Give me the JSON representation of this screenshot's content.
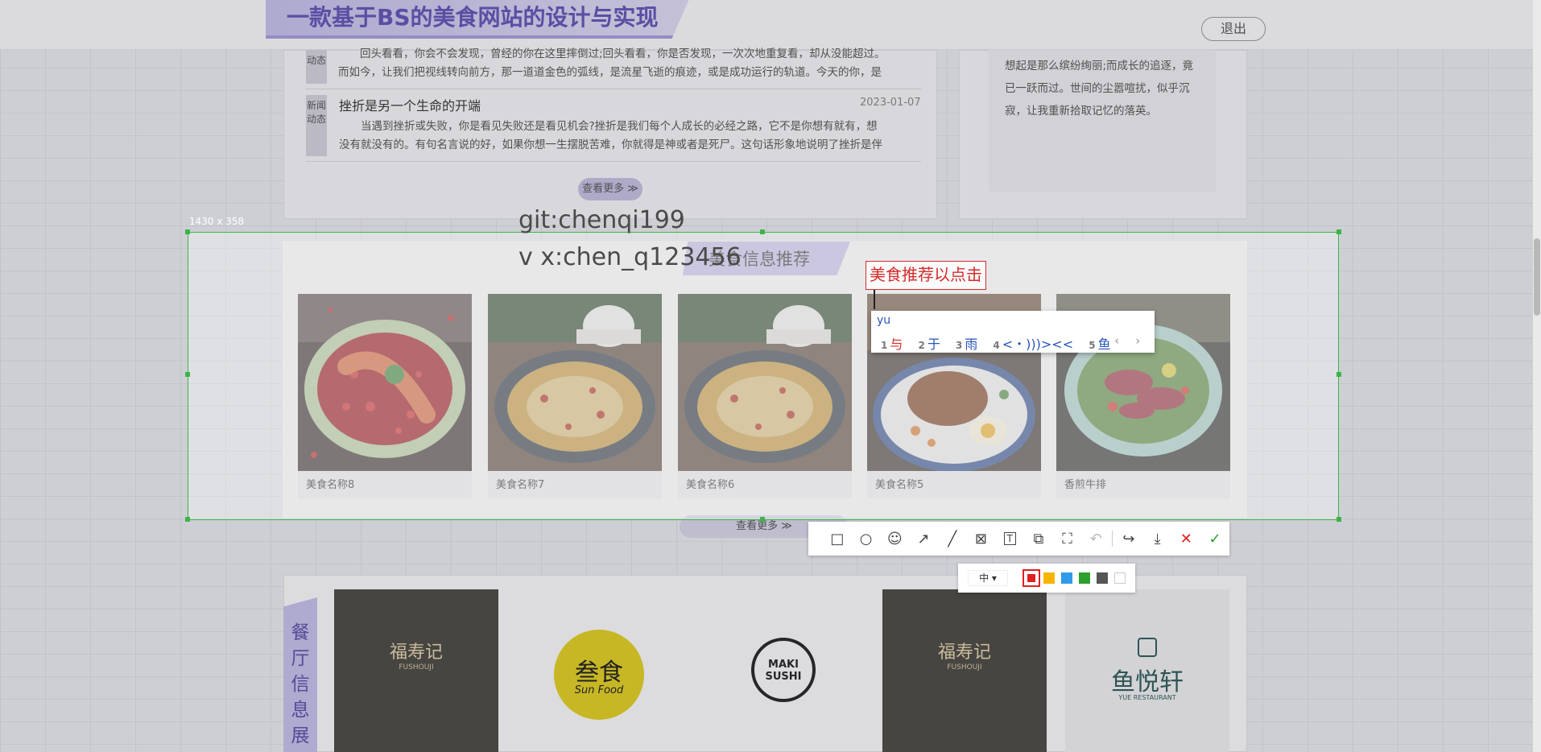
{
  "header": {
    "site_title": "一款基于BS的美食网站的设计与实现",
    "logout_label": "退出"
  },
  "news": {
    "items": [
      {
        "tag": "动态",
        "title": "",
        "date": "",
        "line1": "回头看看，你会不会发现，曾经的你在这里摔倒过;回头看看，你是否发现，一次次地重复看，却从没能超过。",
        "line2": "而如今，让我们把视线转向前方，那一道道金色的弧线，是流星飞逝的痕迹，或是成功运行的轨道。今天的你，是"
      },
      {
        "tag": "新闻动态",
        "title": "挫折是另一个生命的开端",
        "date": "2023-01-07",
        "line1": "当遇到挫折或失败，你是看见失败还是看见机会?挫折是我们每个人成长的必经之路，它不是你想有就有，想",
        "line2": "没有就没有的。有句名言说的好，如果你想一生摆脱苦难，你就得是神或者是死尸。这句话形象地说明了挫折是伴"
      }
    ],
    "more_label": "查看更多 ≫"
  },
  "side": {
    "text": "想起是那么缤纷绚丽;而成长的追逐，竟已一跃而过。世间的尘嚣喧扰，似乎沉寂，让我重新拾取记忆的落英。"
  },
  "capture": {
    "size_label": "1430 x 358"
  },
  "watermark": {
    "line1": "git:chenqi199",
    "line2": "v x:chen_q123456"
  },
  "food": {
    "section_title": "美食信息推荐",
    "cards": [
      {
        "name": "美食名称8",
        "icon": "lobster-dish-photo"
      },
      {
        "name": "美食名称7",
        "icon": "fish-stew-photo"
      },
      {
        "name": "美食名称6",
        "icon": "fish-stew-photo"
      },
      {
        "name": "美食名称5",
        "icon": "rice-bowl-photo"
      },
      {
        "name": "香煎牛排",
        "icon": "steak-salad-photo"
      }
    ],
    "more_label": "查看更多 ≫"
  },
  "annotation": {
    "text": "美食推荐以点击"
  },
  "ime": {
    "input": "yu",
    "candidates": [
      {
        "n": "1",
        "text": "与"
      },
      {
        "n": "2",
        "text": "于"
      },
      {
        "n": "3",
        "text": "雨"
      },
      {
        "n": "4",
        "text": "<・)))><<"
      },
      {
        "n": "5",
        "text": "鱼"
      }
    ],
    "nav": "‹ ›"
  },
  "toolbar": {
    "tools": [
      "rectangle-icon",
      "ellipse-icon",
      "emoji-icon",
      "arrow-icon",
      "line-icon",
      "mosaic-icon",
      "text-icon",
      "pin-icon",
      "ocr-icon",
      "undo-icon",
      "share-icon",
      "save-icon",
      "cancel-icon",
      "confirm-icon"
    ],
    "font_size_label": "中 ▾",
    "colors": [
      "#e02020",
      "#f7b500",
      "#2f9be8",
      "#2ca02c",
      "#555555",
      "#ffffff"
    ],
    "selected_color": "#e02020"
  },
  "restaurants": {
    "section_title": "餐厅信息展示",
    "logos": [
      {
        "name": "福寿记",
        "sub": "FUSHOUJI",
        "bg": "#4a4740",
        "fg": "#e0c89a"
      },
      {
        "name": "叁食",
        "sub": "Sun Food",
        "bg": "#ffffff",
        "fg": "#222222"
      },
      {
        "name": "MAKI SUSHI",
        "sub": "",
        "bg": "#ffffff",
        "fg": "#222222"
      },
      {
        "name": "福寿记",
        "sub": "FUSHOUJI",
        "bg": "#4a4740",
        "fg": "#e0c89a"
      },
      {
        "name": "鱼悦轩",
        "sub": "YUE RESTAURANT",
        "bg": "#f5f5f5",
        "fg": "#2c5a5a"
      }
    ]
  }
}
